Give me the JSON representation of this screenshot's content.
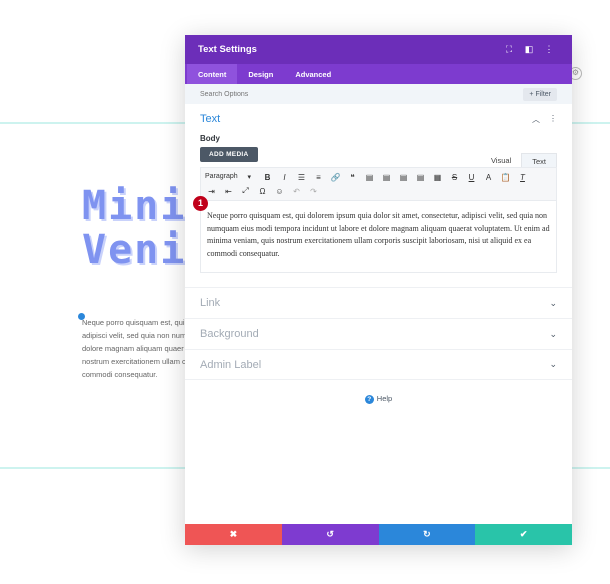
{
  "background": {
    "heading_lines": [
      "Mini",
      "Veni"
    ],
    "paragraph_lines": [
      "Neque porro quisquam est, qui",
      "adipisci velit, sed quia non num",
      "dolore magnam aliquam quaer",
      "nostrum exercitationem ullam c",
      "commodi consequatur."
    ]
  },
  "modal": {
    "title": "Text Settings",
    "header_icons": [
      "expand-icon",
      "sidebar-icon",
      "more-icon"
    ],
    "tabs": [
      "Content",
      "Design",
      "Advanced"
    ],
    "active_tab": "Content",
    "search": {
      "placeholder": "Search Options",
      "filter_label": "+ Filter"
    },
    "text_section": {
      "title": "Text",
      "body_label": "Body",
      "add_media": "ADD MEDIA",
      "editor_tabs": [
        "Visual",
        "Text"
      ],
      "active_editor_tab": "Text",
      "paragraph_select": "Paragraph",
      "content": "Neque porro quisquam est, qui dolorem ipsum quia dolor sit amet, consectetur, adipisci velit, sed quia non numquam eius modi tempora incidunt ut labore et dolore magnam aliquam quaerat voluptatem. Ut enim ad minima veniam, quis nostrum exercitationem ullam corporis suscipit laboriosam, nisi ut aliquid ex ea commodi consequatur."
    },
    "collapsed_sections": [
      "Link",
      "Background",
      "Admin Label"
    ],
    "help_label": "Help",
    "marker_number": "1",
    "footer_colors": {
      "cancel": "#ef5555",
      "undo": "#7e3bd0",
      "redo": "#2b87da",
      "save": "#29c4a9"
    }
  },
  "colors": {
    "header": "#6c2eb9",
    "tabs": "#7d3bcf",
    "accent_blue": "#2b87da",
    "heading_blue": "#7f93f0"
  }
}
